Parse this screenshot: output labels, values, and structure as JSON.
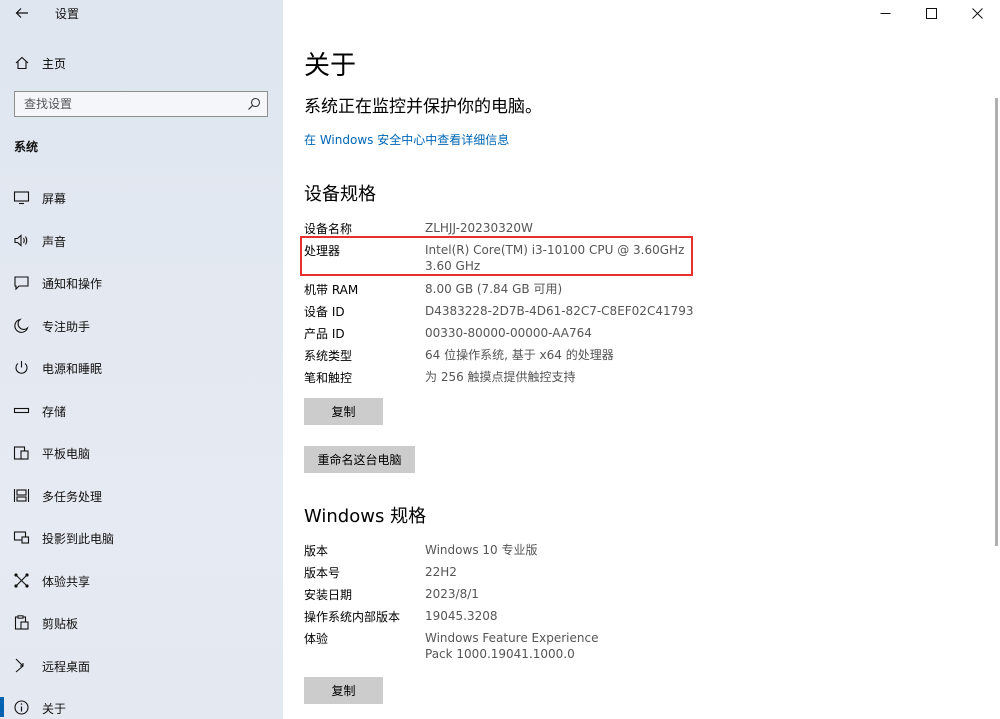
{
  "window": {
    "title": "设置"
  },
  "sidebar": {
    "home_label": "主页",
    "search_placeholder": "查找设置",
    "section_label": "系统",
    "items": [
      {
        "label": "屏幕",
        "icon": "monitor-icon"
      },
      {
        "label": "声音",
        "icon": "speaker-icon"
      },
      {
        "label": "通知和操作",
        "icon": "notification-icon"
      },
      {
        "label": "专注助手",
        "icon": "moon-icon"
      },
      {
        "label": "电源和睡眠",
        "icon": "power-icon"
      },
      {
        "label": "存储",
        "icon": "storage-icon"
      },
      {
        "label": "平板电脑",
        "icon": "tablet-icon"
      },
      {
        "label": "多任务处理",
        "icon": "multitask-icon"
      },
      {
        "label": "投影到此电脑",
        "icon": "project-icon"
      },
      {
        "label": "体验共享",
        "icon": "share-experience-icon"
      },
      {
        "label": "剪贴板",
        "icon": "clipboard-icon"
      },
      {
        "label": "远程桌面",
        "icon": "remote-desktop-icon"
      },
      {
        "label": "关于",
        "icon": "info-icon",
        "active": true
      }
    ]
  },
  "main": {
    "title": "关于",
    "status": "系统正在监控并保护你的电脑。",
    "security_link": "在 Windows 安全中心中查看详细信息",
    "device_specs": {
      "heading": "设备规格",
      "rows": [
        {
          "key": "设备名称",
          "value": "ZLHJJ-20230320W"
        },
        {
          "key": "处理器",
          "value": "Intel(R) Core(TM) i3-10100 CPU @ 3.60GHz   3.60 GHz"
        },
        {
          "key": "机带 RAM",
          "value": "8.00 GB (7.84 GB 可用)"
        },
        {
          "key": "设备 ID",
          "value": "D4383228-2D7B-4D61-82C7-C8EF02C41793"
        },
        {
          "key": "产品 ID",
          "value": "00330-80000-00000-AA764"
        },
        {
          "key": "系统类型",
          "value": "64 位操作系统, 基于 x64 的处理器"
        },
        {
          "key": "笔和触控",
          "value": "为 256 触摸点提供触控支持"
        }
      ],
      "copy_button": "复制",
      "rename_button": "重命名这台电脑"
    },
    "windows_specs": {
      "heading": "Windows 规格",
      "rows": [
        {
          "key": "版本",
          "value": "Windows 10 专业版"
        },
        {
          "key": "版本号",
          "value": "22H2"
        },
        {
          "key": "安装日期",
          "value": "2023/8/1"
        },
        {
          "key": "操作系统内部版本",
          "value": "19045.3208"
        },
        {
          "key": "体验",
          "value": "Windows Feature Experience Pack 1000.19041.1000.0"
        }
      ],
      "copy_button": "复制"
    }
  },
  "colors": {
    "accent": "#0063b1",
    "link": "#0066b4",
    "highlight": "#e8312d"
  }
}
